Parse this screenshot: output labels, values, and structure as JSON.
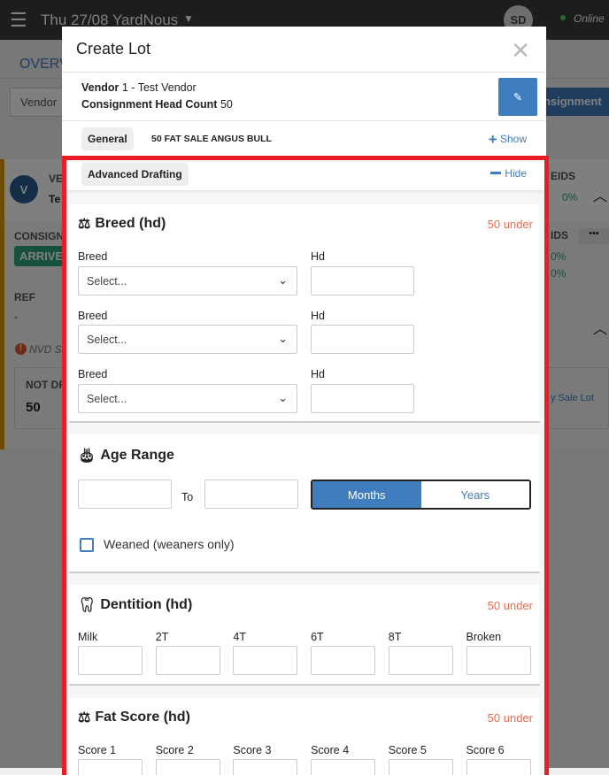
{
  "topbar": {
    "title": "Thu 27/08 YardNous",
    "avatar": "SD",
    "status": "Online"
  },
  "background": {
    "overview": "OVERV",
    "vendor_field": "Vendor",
    "consignment_button": "onsignment",
    "avatar_letter": "V",
    "ve": "VE",
    "te": "Te",
    "consign": "CONSIGN",
    "arrived": "ARRIVE",
    "ref": "REF",
    "ref_value": "-",
    "nvd": "NVD S",
    "not_drafted": "NOT DF",
    "not_drafted_value": "50",
    "eids1": "EIDS",
    "eids1_value": "0%",
    "eids2": "IDS",
    "pct1": "0%",
    "pct2": "0%",
    "sale_lot": "y Sale Lot",
    "more": "•••"
  },
  "modal": {
    "title": "Create Lot",
    "vendor_label": "Vendor",
    "vendor_value": "1 - Test Vendor",
    "headcount_label": "Consignment Head Count",
    "headcount_value": "50",
    "general_label": "General",
    "general_summary": "50 FAT SALE ANGUS BULL",
    "show_label": "Show",
    "advanced_label": "Advanced Drafting",
    "hide_label": "Hide",
    "breed": {
      "title": "Breed (hd)",
      "under": "50 under",
      "rows": [
        {
          "breed_label": "Breed",
          "placeholder": "Select...",
          "hd_label": "Hd"
        },
        {
          "breed_label": "Breed",
          "placeholder": "Select...",
          "hd_label": "Hd"
        },
        {
          "breed_label": "Breed",
          "placeholder": "Select...",
          "hd_label": "Hd"
        }
      ]
    },
    "age": {
      "title": "Age Range",
      "to": "To",
      "months": "Months",
      "years": "Years",
      "selected": "Months",
      "weaned": "Weaned (weaners only)",
      "weaned_checked": false
    },
    "dentition": {
      "title": "Dentition (hd)",
      "under": "50 under",
      "fields": [
        "Milk",
        "2T",
        "4T",
        "6T",
        "8T",
        "Broken"
      ]
    },
    "fat": {
      "title": "Fat Score (hd)",
      "under": "50 under",
      "fields": [
        "Score 1",
        "Score 2",
        "Score 3",
        "Score 4",
        "Score 5",
        "Score 6"
      ]
    }
  },
  "colors": {
    "accent": "#3f7dbf",
    "highlight_border": "#ec1c24",
    "under": "#ea6b4e",
    "arrived": "#2aa37a",
    "card_border": "#d89b00"
  }
}
